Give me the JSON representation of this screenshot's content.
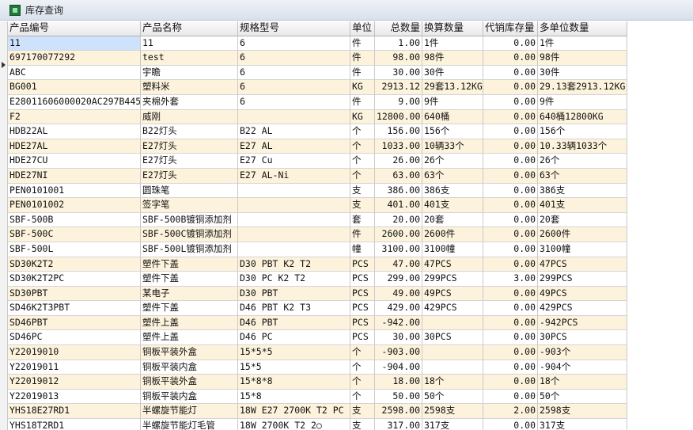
{
  "window": {
    "title": "库存查询"
  },
  "columns": [
    "产品编号",
    "产品名称",
    "规格型号",
    "单位",
    "总数量",
    "换算数量",
    "代销库存量",
    "多单位数量"
  ],
  "rows": [
    [
      "11",
      "11",
      "6",
      "件",
      "1.00",
      "1件",
      "0.00",
      "1件"
    ],
    [
      "697170077292",
      "test",
      "6",
      "件",
      "98.00",
      "98件",
      "0.00",
      "98件"
    ],
    [
      "ABC",
      "宇瞻",
      "6",
      "件",
      "30.00",
      "30件",
      "0.00",
      "30件"
    ],
    [
      "BG001",
      "塑料米",
      "6",
      "KG",
      "2913.12",
      "29套13.12KG",
      "0.00",
      "29.13套2913.12KG"
    ],
    [
      "E28011606000020AC297B445",
      "夹棉外套",
      "6",
      "件",
      "9.00",
      "9件",
      "0.00",
      "9件"
    ],
    [
      "F2",
      "威刚",
      "",
      "KG",
      "12800.00",
      "640桶",
      "0.00",
      "640桶12800KG"
    ],
    [
      "HDB22AL",
      "B22灯头",
      "B22 AL",
      "个",
      "156.00",
      "156个",
      "0.00",
      "156个"
    ],
    [
      "HDE27AL",
      "E27灯头",
      "E27 AL",
      "个",
      "1033.00",
      "10辆33个",
      "0.00",
      "10.33辆1033个"
    ],
    [
      "HDE27CU",
      "E27灯头",
      "E27 Cu",
      "个",
      "26.00",
      "26个",
      "0.00",
      "26个"
    ],
    [
      "HDE27NI",
      "E27灯头",
      "E27 AL-Ni",
      "个",
      "63.00",
      "63个",
      "0.00",
      "63个"
    ],
    [
      "PEN0101001",
      "圆珠笔",
      "",
      "支",
      "386.00",
      "386支",
      "0.00",
      "386支"
    ],
    [
      "PEN0101002",
      "签字笔",
      "",
      "支",
      "401.00",
      "401支",
      "0.00",
      "401支"
    ],
    [
      "SBF-500B",
      "SBF-500B镀铜添加剂",
      "",
      "套",
      "20.00",
      "20套",
      "0.00",
      "20套"
    ],
    [
      "SBF-500C",
      "SBF-500C镀铜添加剂",
      "",
      "件",
      "2600.00",
      "2600件",
      "0.00",
      "2600件"
    ],
    [
      "SBF-500L",
      "SBF-500L镀铜添加剂",
      "",
      "幢",
      "3100.00",
      "3100幢",
      "0.00",
      "3100幢"
    ],
    [
      "SD30K2T2",
      "塑件下盖",
      "D30 PBT K2 T2",
      "PCS",
      "47.00",
      "47PCS",
      "0.00",
      "47PCS"
    ],
    [
      "SD30K2T2PC",
      "塑件下盖",
      "D30 PC K2 T2",
      "PCS",
      "299.00",
      "299PCS",
      "3.00",
      "299PCS"
    ],
    [
      "SD30PBT",
      "某电子",
      "D30 PBT",
      "PCS",
      "49.00",
      "49PCS",
      "0.00",
      "49PCS"
    ],
    [
      "SD46K2T3PBT",
      "塑件下盖",
      "D46 PBT K2 T3",
      "PCS",
      "429.00",
      "429PCS",
      "0.00",
      "429PCS"
    ],
    [
      "SD46PBT",
      "塑件上盖",
      "D46 PBT",
      "PCS",
      "-942.00",
      "",
      "0.00",
      "-942PCS"
    ],
    [
      "SD46PC",
      "塑件上盖",
      "D46 PC",
      "PCS",
      "30.00",
      "30PCS",
      "0.00",
      "30PCS"
    ],
    [
      "Y22019010",
      "铜板平装外盒",
      "15*5*5",
      "个",
      "-903.00",
      "",
      "0.00",
      "-903个"
    ],
    [
      "Y22019011",
      "铜板平装内盒",
      "15*5",
      "个",
      "-904.00",
      "",
      "0.00",
      "-904个"
    ],
    [
      "Y22019012",
      "铜板平装外盒",
      "15*8*8",
      "个",
      "18.00",
      "18个",
      "0.00",
      "18个"
    ],
    [
      "Y22019013",
      "铜板平装内盒",
      "15*8",
      "个",
      "50.00",
      "50个",
      "0.00",
      "50个"
    ],
    [
      "YHS18E27RD1",
      "半螺旋节能灯",
      "18W E27 2700K T2 PC",
      "支",
      "2598.00",
      "2598支",
      "2.00",
      "2598支"
    ],
    [
      "YHS18T2RD1",
      "半螺旋节能灯毛管",
      "18W 2700K T2 2○",
      "支",
      "317.00",
      "317支",
      "0.00",
      "317支"
    ]
  ],
  "selected_row": 0,
  "colors": {
    "alt_row": "#fdf3dc",
    "header_bg": "#e9e9e9",
    "title_bg": "#d9e1ec"
  }
}
